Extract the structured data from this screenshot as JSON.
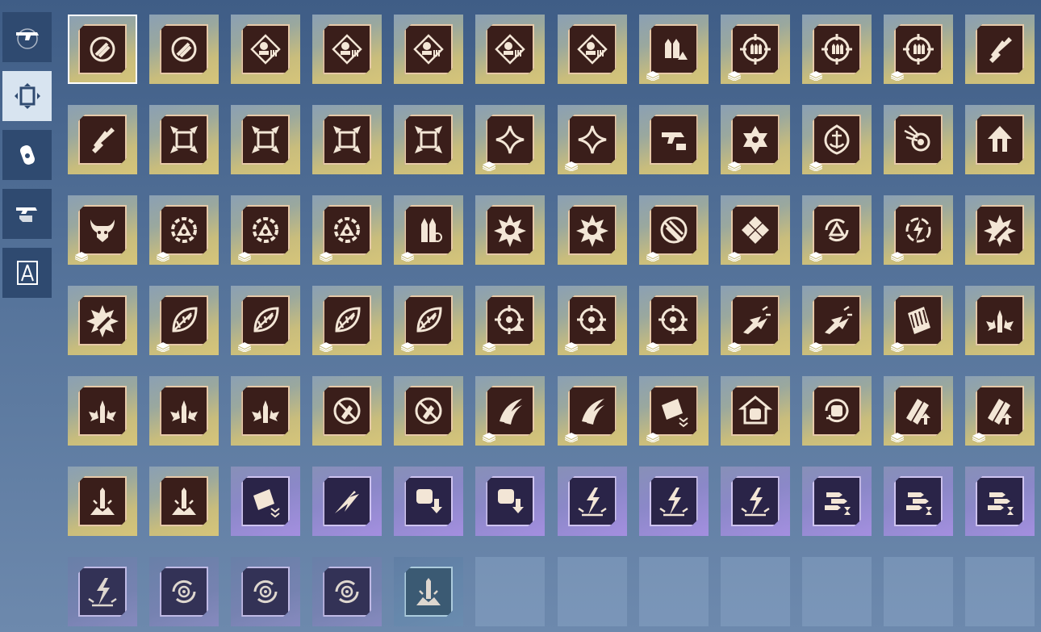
{
  "sidebar": {
    "tabs": [
      {
        "icon": "gun-icon",
        "active": false
      },
      {
        "icon": "frame-icon",
        "active": true
      },
      {
        "icon": "grenade-icon",
        "active": false
      },
      {
        "icon": "hand-gun-icon",
        "active": false
      },
      {
        "icon": "compass-icon",
        "active": false
      }
    ]
  },
  "grid": {
    "cards": [
      {
        "rarity": "gold",
        "icon": "rocket-circle-icon",
        "stack": false,
        "selected": true
      },
      {
        "rarity": "gold",
        "icon": "rocket-circle-icon",
        "stack": false
      },
      {
        "rarity": "gold",
        "icon": "target-head-ammo-icon",
        "stack": false
      },
      {
        "rarity": "gold",
        "icon": "target-head-ammo-icon",
        "stack": false
      },
      {
        "rarity": "gold",
        "icon": "target-head-ammo-icon",
        "stack": false
      },
      {
        "rarity": "gold",
        "icon": "target-head-ammo-icon",
        "stack": false
      },
      {
        "rarity": "gold",
        "icon": "target-head-ammo-icon",
        "stack": false
      },
      {
        "rarity": "gold",
        "icon": "ammo-warning-icon",
        "stack": true
      },
      {
        "rarity": "gold",
        "icon": "crosshair-ammo-icon",
        "stack": true
      },
      {
        "rarity": "gold",
        "icon": "crosshair-ammo-icon",
        "stack": true
      },
      {
        "rarity": "gold",
        "icon": "crosshair-ammo-icon",
        "stack": true
      },
      {
        "rarity": "gold",
        "icon": "rockets-icon",
        "stack": false
      },
      {
        "rarity": "gold",
        "icon": "rockets-icon",
        "stack": false
      },
      {
        "rarity": "gold",
        "icon": "shrink-arrows-icon",
        "stack": false
      },
      {
        "rarity": "gold",
        "icon": "shrink-arrows-icon",
        "stack": false
      },
      {
        "rarity": "gold",
        "icon": "shrink-arrows-icon",
        "stack": false
      },
      {
        "rarity": "gold",
        "icon": "shrink-arrows-icon",
        "stack": false
      },
      {
        "rarity": "gold",
        "icon": "star-diamond-icon",
        "stack": true
      },
      {
        "rarity": "gold",
        "icon": "star-diamond-icon",
        "stack": true
      },
      {
        "rarity": "gold",
        "icon": "gun-ammo-icon",
        "stack": false
      },
      {
        "rarity": "gold",
        "icon": "hex-star-icon",
        "stack": true
      },
      {
        "rarity": "gold",
        "icon": "anchor-shield-icon",
        "stack": true
      },
      {
        "rarity": "gold",
        "icon": "comet-target-icon",
        "stack": false
      },
      {
        "rarity": "gold",
        "icon": "up-arrows-icon",
        "stack": false
      },
      {
        "rarity": "gold",
        "icon": "bull-skull-icon",
        "stack": true
      },
      {
        "rarity": "gold",
        "icon": "gear-triangle-icon",
        "stack": true
      },
      {
        "rarity": "gold",
        "icon": "gear-triangle-icon",
        "stack": true
      },
      {
        "rarity": "gold",
        "icon": "gear-triangle-icon",
        "stack": true
      },
      {
        "rarity": "gold",
        "icon": "bullets-gear-icon",
        "stack": true
      },
      {
        "rarity": "gold",
        "icon": "burst-icon",
        "stack": false
      },
      {
        "rarity": "gold",
        "icon": "burst-icon",
        "stack": false
      },
      {
        "rarity": "gold",
        "icon": "blade-slash-icon",
        "stack": true
      },
      {
        "rarity": "gold",
        "icon": "shatter-icon",
        "stack": true
      },
      {
        "rarity": "gold",
        "icon": "cycle-triangle-icon",
        "stack": true
      },
      {
        "rarity": "gold",
        "icon": "lightning-target-icon",
        "stack": true
      },
      {
        "rarity": "gold",
        "icon": "bullet-explosion-icon",
        "stack": false
      },
      {
        "rarity": "gold",
        "icon": "bullet-explosion-icon",
        "stack": false
      },
      {
        "rarity": "gold",
        "icon": "leaf-blade-icon",
        "stack": true
      },
      {
        "rarity": "gold",
        "icon": "leaf-blade-icon",
        "stack": true
      },
      {
        "rarity": "gold",
        "icon": "leaf-blade-icon",
        "stack": true
      },
      {
        "rarity": "gold",
        "icon": "leaf-blade-icon",
        "stack": true
      },
      {
        "rarity": "gold",
        "icon": "crosshair-up-icon",
        "stack": true
      },
      {
        "rarity": "gold",
        "icon": "crosshair-up-icon",
        "stack": true
      },
      {
        "rarity": "gold",
        "icon": "crosshair-up-icon",
        "stack": true
      },
      {
        "rarity": "gold",
        "icon": "impact-icon",
        "stack": true
      },
      {
        "rarity": "gold",
        "icon": "impact-icon",
        "stack": true
      },
      {
        "rarity": "gold",
        "icon": "ammo-rack-icon",
        "stack": true
      },
      {
        "rarity": "gold",
        "icon": "bullet-burst-icon",
        "stack": false
      },
      {
        "rarity": "gold",
        "icon": "bullet-burst-icon",
        "stack": false
      },
      {
        "rarity": "gold",
        "icon": "bullet-burst-icon",
        "stack": false
      },
      {
        "rarity": "gold",
        "icon": "bullet-burst-icon",
        "stack": false
      },
      {
        "rarity": "gold",
        "icon": "no-bullet-icon",
        "stack": false
      },
      {
        "rarity": "gold",
        "icon": "no-bullet-icon",
        "stack": false
      },
      {
        "rarity": "gold",
        "icon": "claw-slash-icon",
        "stack": true
      },
      {
        "rarity": "gold",
        "icon": "claw-slash-icon",
        "stack": true
      },
      {
        "rarity": "gold",
        "icon": "ammo-chevron-icon",
        "stack": true
      },
      {
        "rarity": "gold",
        "icon": "house-fist-icon",
        "stack": false
      },
      {
        "rarity": "gold",
        "icon": "fist-cycle-icon",
        "stack": false
      },
      {
        "rarity": "gold",
        "icon": "ammo-up-icon",
        "stack": true
      },
      {
        "rarity": "gold",
        "icon": "ammo-up-icon",
        "stack": true
      },
      {
        "rarity": "gold",
        "icon": "bullet-blast-icon",
        "stack": false
      },
      {
        "rarity": "gold",
        "icon": "bullet-blast-icon",
        "stack": false
      },
      {
        "rarity": "purple",
        "icon": "ammo-chevron-icon",
        "stack": false
      },
      {
        "rarity": "purple",
        "icon": "arrow-burst-icon",
        "stack": false
      },
      {
        "rarity": "purple",
        "icon": "fist-down-icon",
        "stack": false
      },
      {
        "rarity": "purple",
        "icon": "fist-down-icon",
        "stack": false
      },
      {
        "rarity": "purple",
        "icon": "lightning-burst-icon",
        "stack": false
      },
      {
        "rarity": "purple",
        "icon": "lightning-burst-icon",
        "stack": false
      },
      {
        "rarity": "purple",
        "icon": "lightning-burst-icon",
        "stack": false
      },
      {
        "rarity": "purple",
        "icon": "bullets-hourglass-icon",
        "stack": false
      },
      {
        "rarity": "purple",
        "icon": "bullets-hourglass-icon",
        "stack": false
      },
      {
        "rarity": "purple",
        "icon": "bullets-hourglass-icon",
        "stack": false
      },
      {
        "rarity": "dimpurple",
        "icon": "lightning-burst-icon",
        "stack": false
      },
      {
        "rarity": "dimpurple",
        "icon": "cycle-target-icon",
        "stack": false
      },
      {
        "rarity": "dimpurple",
        "icon": "cycle-target-icon",
        "stack": false
      },
      {
        "rarity": "dimpurple",
        "icon": "cycle-target-icon",
        "stack": false
      },
      {
        "rarity": "dimteal",
        "icon": "bullet-blast-icon",
        "stack": false
      },
      {
        "rarity": "empty"
      },
      {
        "rarity": "empty"
      },
      {
        "rarity": "empty"
      },
      {
        "rarity": "empty"
      },
      {
        "rarity": "empty"
      },
      {
        "rarity": "empty"
      },
      {
        "rarity": "empty"
      }
    ]
  }
}
